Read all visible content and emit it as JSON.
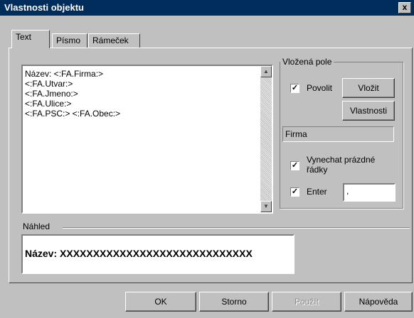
{
  "window": {
    "title": "Vlastnosti objektu",
    "close_glyph": "x"
  },
  "tabs": [
    {
      "label": "Text",
      "active": true
    },
    {
      "label": "Písmo"
    },
    {
      "label": "Rámeček"
    }
  ],
  "text_content": {
    "lines": [
      "Název: <:FA.Firma:>",
      "<:FA.Utvar:>",
      "<:FA.Jmeno:>",
      "<:FA.Ulice:>",
      "<:FA.PSC:> <:FA.Obec:>"
    ]
  },
  "vlozena_pole": {
    "legend": "Vložená pole",
    "povolit": {
      "label": "Povolit",
      "checked": true
    },
    "vlozit_button": "Vložit",
    "vlastnosti_button": "Vlastnosti",
    "field_value": "Firma",
    "vynechat": {
      "label_line1": "Vynechat prázdné",
      "label_line2": "řádky",
      "checked": true
    },
    "enter": {
      "label": "Enter",
      "checked": true,
      "value": ","
    }
  },
  "nahled": {
    "label": "Náhled",
    "preview_text": "Název: XXXXXXXXXXXXXXXXXXXXXXXXXXXXX"
  },
  "buttons": {
    "ok": "OK",
    "storno": "Storno",
    "pouzit": "Použít",
    "napoveda": "Nápověda"
  },
  "icons": {
    "scroll_up": "▲",
    "scroll_down": "▼",
    "check": "✓"
  }
}
